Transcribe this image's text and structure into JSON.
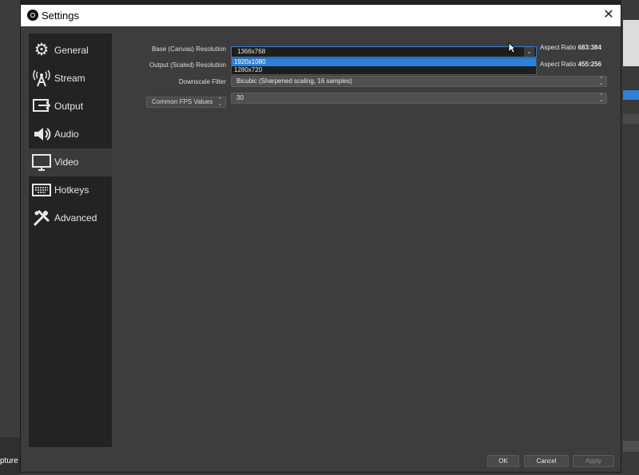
{
  "window": {
    "title": "Settings",
    "close_glyph": "✕"
  },
  "background": {
    "capture_label": "pture"
  },
  "sidebar": {
    "items": [
      {
        "label": "General",
        "icon": "gear-icon",
        "glyph": "⚙"
      },
      {
        "label": "Stream",
        "icon": "broadcast-icon",
        "glyph": "📡"
      },
      {
        "label": "Output",
        "icon": "output-icon",
        "glyph": "⇥"
      },
      {
        "label": "Audio",
        "icon": "speaker-icon",
        "glyph": "🔊"
      },
      {
        "label": "Video",
        "icon": "monitor-icon",
        "glyph": "🖵"
      },
      {
        "label": "Hotkeys",
        "icon": "keyboard-icon",
        "glyph": "⌨"
      },
      {
        "label": "Advanced",
        "icon": "wrench-icon",
        "glyph": "✖"
      }
    ],
    "active": "Video"
  },
  "video": {
    "base_resolution": {
      "label": "Base (Canvas) Resolution",
      "value": "1366x768",
      "aspect_label": "Aspect Ratio",
      "aspect_value": "683:384",
      "dropdown_options": [
        "1920x1080",
        "1280x720"
      ],
      "highlighted_option": "1920x1080"
    },
    "output_resolution": {
      "label": "Output (Scaled) Resolution",
      "aspect_label": "Aspect Ratio",
      "aspect_value": "455:256"
    },
    "downscale_filter": {
      "label": "Downscale Filter",
      "value": "Bicubic (Sharpened scaling, 16 samples)"
    },
    "fps": {
      "label": "Common FPS Values",
      "value": "30"
    }
  },
  "buttons": {
    "ok": "OK",
    "cancel": "Cancel",
    "apply": "Apply"
  },
  "colors": {
    "accent": "#2a82da",
    "window_bg": "#3d3d3d",
    "sidebar_bg": "#232323"
  }
}
